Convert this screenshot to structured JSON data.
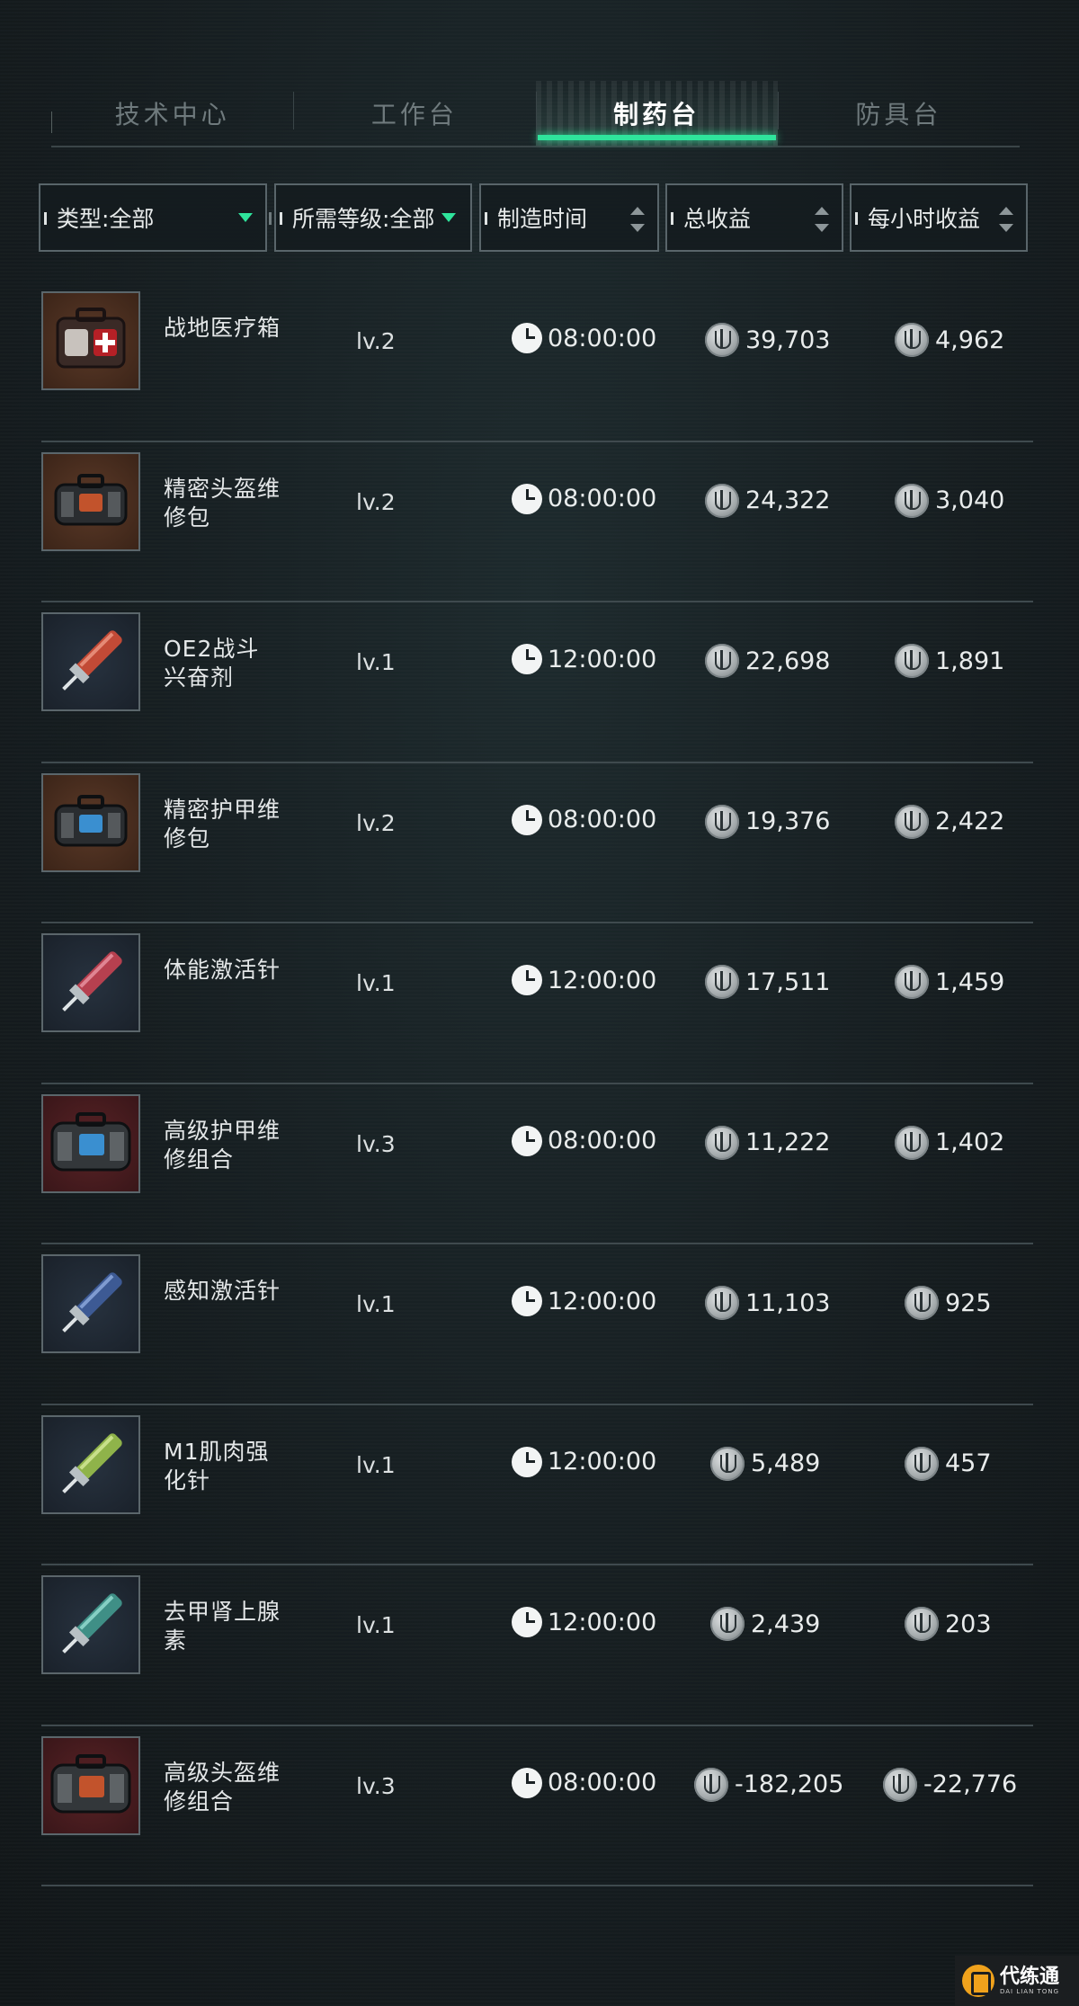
{
  "tabs": [
    {
      "label": "技术中心",
      "active": false
    },
    {
      "label": "工作台",
      "active": false
    },
    {
      "label": "制药台",
      "active": true
    },
    {
      "label": "防具台",
      "active": false
    }
  ],
  "filters": {
    "type": "类型:全部",
    "level": "所需等级:全部",
    "craft_time": "制造时间",
    "total_profit": "总收益",
    "hourly_profit": "每小时收益"
  },
  "colors": {
    "accent": "#2fe49c",
    "background": "#151c1f",
    "border": "#59656a"
  },
  "items": [
    {
      "name": "战地医疗箱",
      "level": "lv.2",
      "time": "08:00:00",
      "total": "39,703",
      "hourly": "4,962",
      "icon": "medkit-icon"
    },
    {
      "name": "精密头盔维修包",
      "level": "lv.2",
      "time": "08:00:00",
      "total": "24,322",
      "hourly": "3,040",
      "icon": "helmet-repair-kit-icon"
    },
    {
      "name": "OE2战斗兴奋剂",
      "level": "lv.1",
      "time": "12:00:00",
      "total": "22,698",
      "hourly": "1,891",
      "icon": "syringe-red-icon"
    },
    {
      "name": "精密护甲维修包",
      "level": "lv.2",
      "time": "08:00:00",
      "total": "19,376",
      "hourly": "2,422",
      "icon": "armor-repair-kit-icon"
    },
    {
      "name": "体能激活针",
      "level": "lv.1",
      "time": "12:00:00",
      "total": "17,511",
      "hourly": "1,459",
      "icon": "syringe-pink-icon"
    },
    {
      "name": "高级护甲维修组合",
      "level": "lv.3",
      "time": "08:00:00",
      "total": "11,222",
      "hourly": "1,402",
      "icon": "armor-repair-set-icon"
    },
    {
      "name": "感知激活针",
      "level": "lv.1",
      "time": "12:00:00",
      "total": "11,103",
      "hourly": "925",
      "icon": "syringe-blue-icon"
    },
    {
      "name": "M1肌肉强化针",
      "level": "lv.1",
      "time": "12:00:00",
      "total": "5,489",
      "hourly": "457",
      "icon": "syringe-green-icon"
    },
    {
      "name": "去甲肾上腺素",
      "level": "lv.1",
      "time": "12:00:00",
      "total": "2,439",
      "hourly": "203",
      "icon": "syringe-teal-icon"
    },
    {
      "name": "高级头盔维修组合",
      "level": "lv.3",
      "time": "08:00:00",
      "total": "-182,205",
      "hourly": "-22,776",
      "icon": "helmet-repair-set-icon"
    }
  ],
  "watermark": {
    "cn": "代练通",
    "en": "DAI LIAN TONG"
  }
}
